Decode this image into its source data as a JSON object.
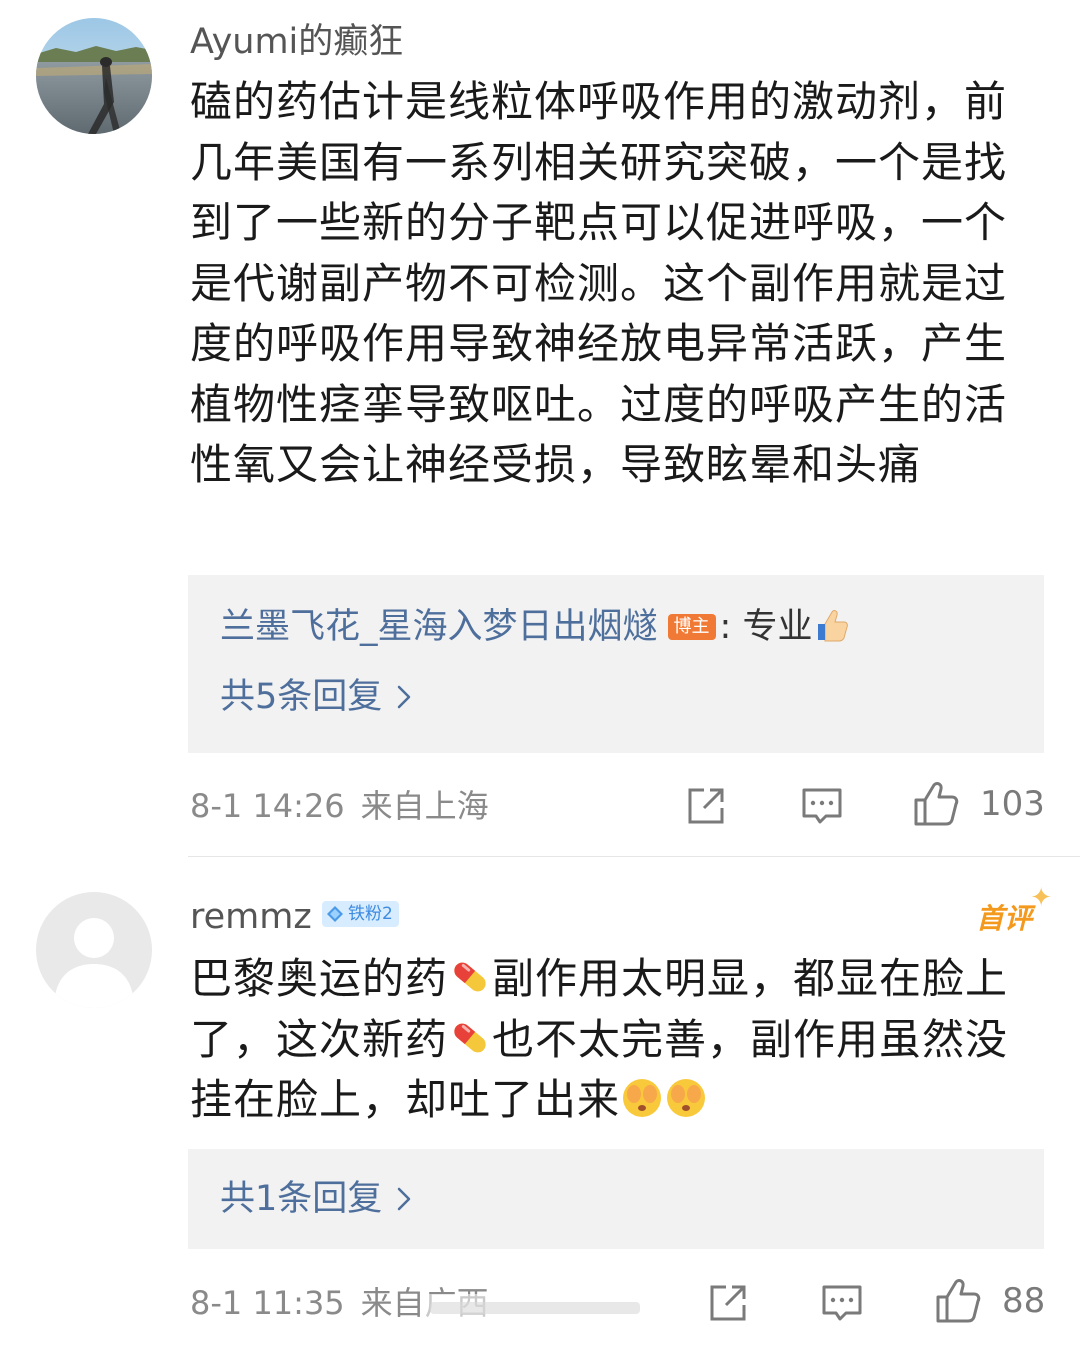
{
  "comments": [
    {
      "username": "Ayumi的癫狂",
      "text": "磕的药估计是线粒体呼吸作用的激动剂，前几年美国有一系列相关研究突破，一个是找到了一些新的分子靶点可以促进呼吸，一个是代谢副产物不可检测。这个副作用就是过度的呼吸作用导致神经放电异常活跃，产生植物性痉挛导致呕吐。过度的呼吸产生的活性氧又会让神经受损，导致眩晕和头痛",
      "reply_preview": {
        "author": "兰墨飞花_星海入梦日出烟燧",
        "tag": "博主",
        "colon": ":",
        "content": "专业"
      },
      "reply_count": "共5条回复",
      "time": "8-1 14:26",
      "location": "来自上海",
      "like_count": "103"
    },
    {
      "username": "remmz",
      "badge": "铁粉2",
      "first_tag": "首评",
      "text_parts": [
        "巴黎奥运的药",
        "副作用太明显，都显在脸上了，这次新药",
        "也不太完善，副作用虽然没挂在脸上，却吐了出来"
      ],
      "reply_count": "共1条回复",
      "time": "8-1 11:35",
      "location": "来自广西",
      "like_count": "88"
    }
  ],
  "colors": {
    "link": "#4e6f9c",
    "meta": "#8a8a8a",
    "reply_bg": "#f2f2f2",
    "blogger_tag": "#f07a35",
    "first_tag": "#f39a1e",
    "fan_badge_bg": "#d8ecff"
  }
}
